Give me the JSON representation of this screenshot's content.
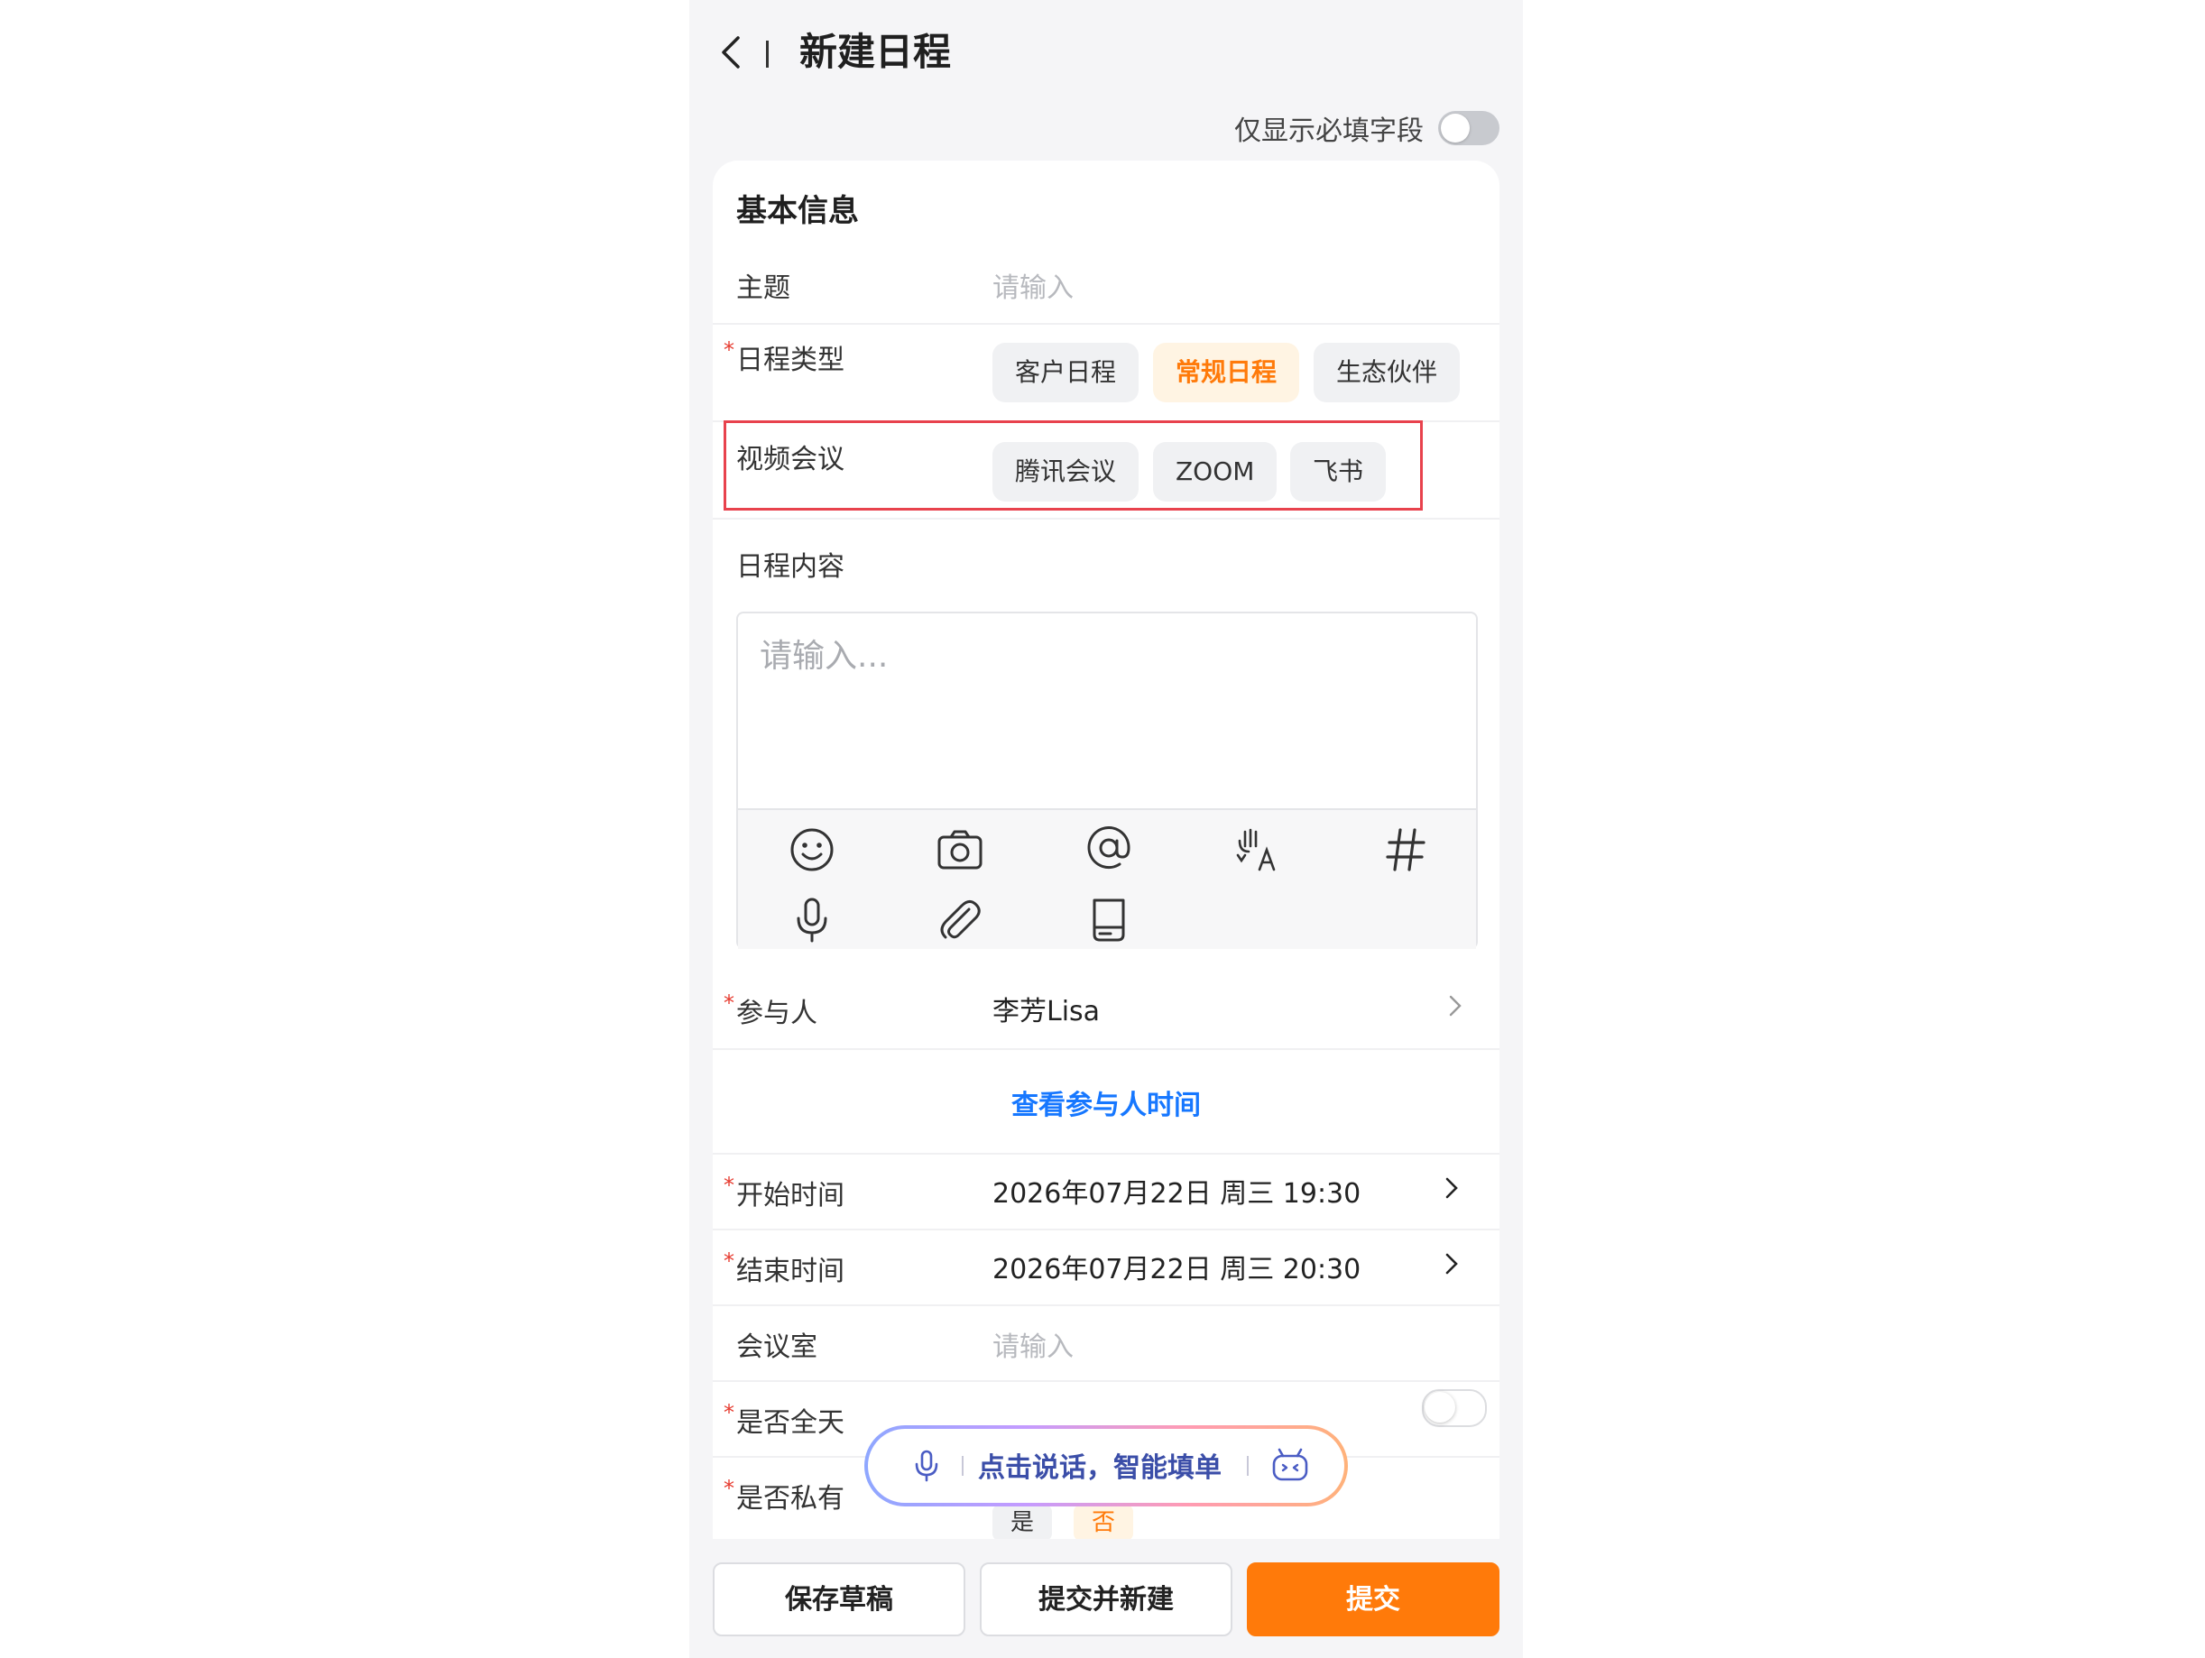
{
  "header": {
    "title": "新建日程",
    "only_required_label": "仅显示必填字段"
  },
  "section": {
    "title": "基本信息"
  },
  "fields": {
    "subject": {
      "label": "主题",
      "placeholder": "请输入"
    },
    "type": {
      "label": "日程类型",
      "options": [
        "客户日程",
        "常规日程",
        "生态伙伴"
      ],
      "selected": "常规日程"
    },
    "video": {
      "label": "视频会议",
      "options": [
        "腾讯会议",
        "ZOOM",
        "飞书"
      ]
    },
    "content": {
      "label": "日程内容",
      "placeholder": "请输入..."
    },
    "participants": {
      "label": "参与人",
      "value": "李芳Lisa"
    },
    "view_time_link": "查看参与人时间",
    "start": {
      "label": "开始时间",
      "value": "2026年07月22日 周三 19:30"
    },
    "end": {
      "label": "结束时间",
      "value": "2026年07月22日 周三 20:30"
    },
    "room": {
      "label": "会议室",
      "placeholder": "请输入"
    },
    "all_day": {
      "label": "是否全天"
    },
    "private": {
      "label": "是否私有",
      "options": [
        "是",
        "否"
      ],
      "selected": "否"
    }
  },
  "voice_assistant": {
    "text": "点击说话，智能填单"
  },
  "actions": {
    "save_draft": "保存草稿",
    "submit_new": "提交并新建",
    "submit": "提交"
  },
  "colors": {
    "accent": "#ff7a0a",
    "link": "#1677ff",
    "required_star": "#e63a2e",
    "highlight_box": "#e8424d"
  },
  "icons": {
    "toolbar": [
      "emoji-icon",
      "camera-icon",
      "at-icon",
      "translate-icon",
      "hashtag-icon",
      "microphone-icon",
      "attachment-icon",
      "drive-icon"
    ]
  }
}
